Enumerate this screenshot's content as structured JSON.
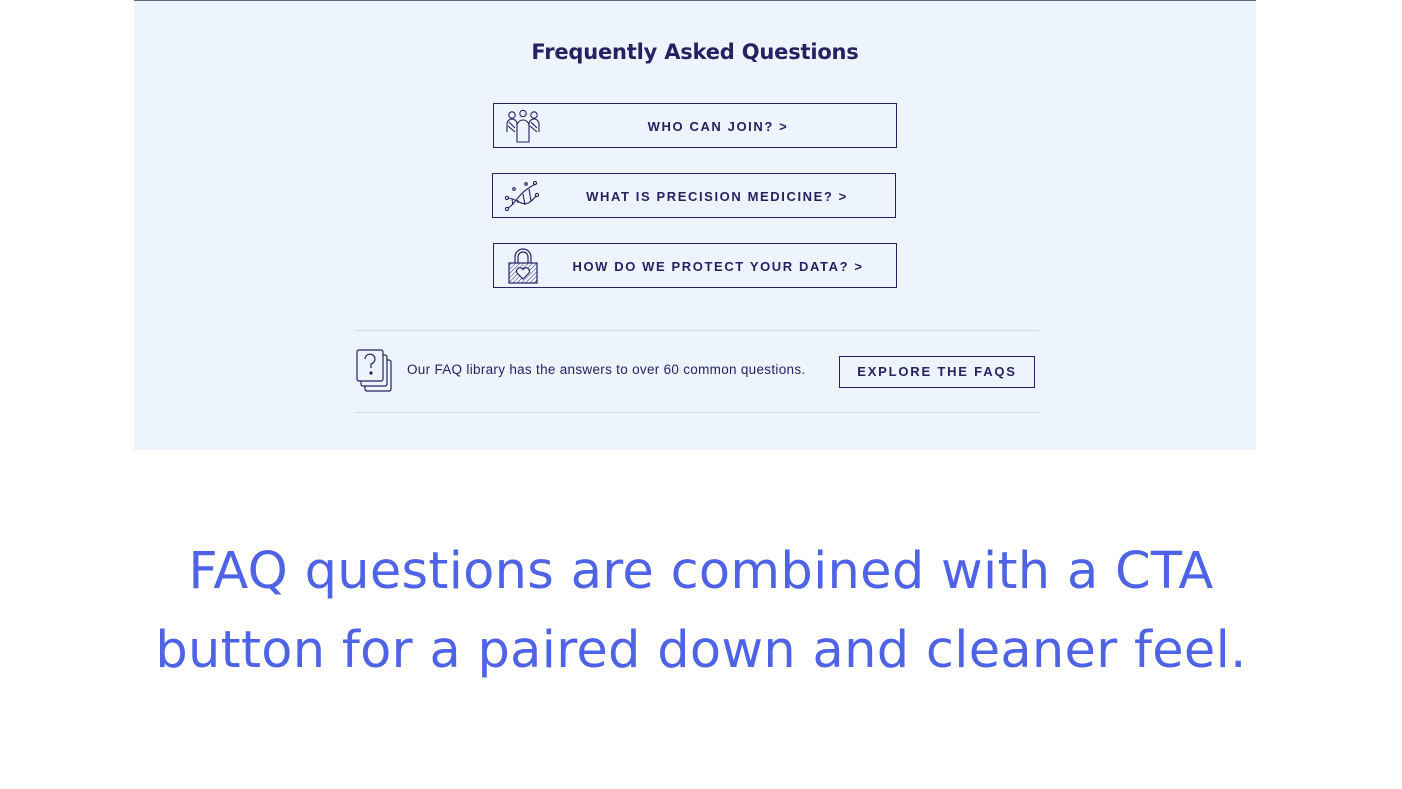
{
  "faq_section": {
    "title": "Frequently Asked Questions",
    "questions": [
      {
        "label": "WHO CAN JOIN? >",
        "icon": "people-group-icon"
      },
      {
        "label": "WHAT IS PRECISION MEDICINE? >",
        "icon": "dna-strand-icon"
      },
      {
        "label": "HOW DO WE PROTECT YOUR DATA? >",
        "icon": "padlock-heart-icon"
      }
    ],
    "library": {
      "icon": "question-stack-icon",
      "text": "Our FAQ library has the answers to over 60 common questions.",
      "cta_label": "EXPLORE THE FAQS"
    }
  },
  "caption": {
    "line1": "FAQ questions are combined with a CTA",
    "line2": "button for a paired down and cleaner feel."
  },
  "colors": {
    "navy": "#262262",
    "panel_bg": "#edf4fd",
    "caption_blue": "#4e63e5"
  }
}
